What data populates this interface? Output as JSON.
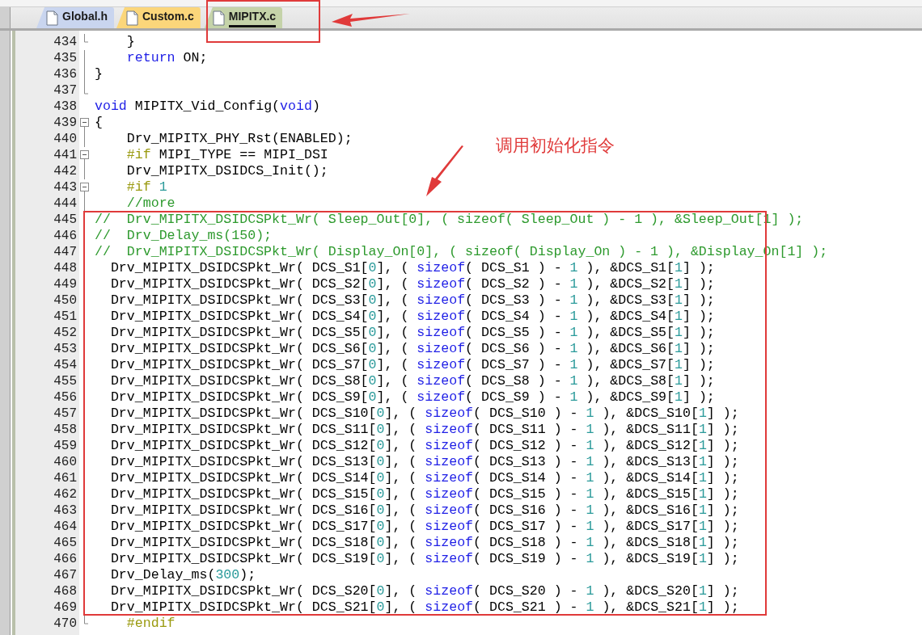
{
  "tabs": [
    {
      "label": "Global.h",
      "color": "#c9d5ef",
      "selected": false
    },
    {
      "label": "Custom.c",
      "color": "#fbd67a",
      "selected": false
    },
    {
      "label": "MIPITX.c",
      "color": "#c5d3a9",
      "selected": true
    }
  ],
  "editor": {
    "lines": [
      {
        "number": "434",
        "kind": "tick",
        "tokens": [
          {
            "kind": "plain",
            "text": "    }"
          }
        ]
      },
      {
        "number": "435",
        "kind": "line",
        "tokens": [
          {
            "kind": "keyword",
            "text": "    return"
          },
          {
            "kind": "plain",
            "text": " ON;"
          }
        ]
      },
      {
        "number": "436",
        "kind": "line",
        "tokens": [
          {
            "kind": "plain",
            "text": "}"
          }
        ]
      },
      {
        "number": "437",
        "kind": "end"
      },
      {
        "number": "438",
        "tokens": [
          {
            "kind": "keyword",
            "text": "void"
          },
          {
            "kind": "plain",
            "text": " MIPITX_Vid_Config("
          },
          {
            "kind": "keyword",
            "text": "void"
          },
          {
            "kind": "plain",
            "text": ")"
          }
        ]
      },
      {
        "number": "439",
        "kind": "box",
        "tokens": [
          {
            "kind": "plain",
            "text": "{"
          }
        ]
      },
      {
        "number": "440",
        "kind": "line",
        "tokens": [
          {
            "kind": "plain",
            "text": "    Drv_MIPITX_PHY_Rst(ENABLED);"
          }
        ]
      },
      {
        "number": "441",
        "kind": "box",
        "tokens": [
          {
            "kind": "preproc",
            "text": "    #if"
          },
          {
            "kind": "plain",
            "text": " MIPI_TYPE == MIPI_DSI"
          }
        ]
      },
      {
        "number": "442",
        "kind": "line",
        "tokens": [
          {
            "kind": "plain",
            "text": "    Drv_MIPITX_DSIDCS_Init();"
          }
        ]
      },
      {
        "number": "443",
        "kind": "box",
        "tokens": [
          {
            "kind": "preproc",
            "text": "    #if"
          },
          {
            "kind": "number",
            "text": " 1"
          }
        ]
      },
      {
        "number": "444",
        "kind": "line",
        "tokens": [
          {
            "kind": "comment",
            "text": "    //more"
          }
        ]
      },
      {
        "number": "445",
        "tokens": [
          {
            "kind": "comment",
            "text": "//  Drv_MIPITX_DSIDCSPkt_Wr( Sleep_Out[0], ( sizeof( Sleep_Out ) - 1 ), &Sleep_Out[1] );"
          }
        ]
      },
      {
        "number": "446",
        "tokens": [
          {
            "kind": "comment",
            "text": "//  Drv_Delay_ms(150);"
          }
        ]
      },
      {
        "number": "447",
        "tokens": [
          {
            "kind": "comment",
            "text": "//  Drv_MIPITX_DSIDCSPkt_Wr( Display_On[0], ( sizeof( Display_On ) - 1 ), &Display_On[1] );"
          }
        ]
      },
      {
        "number": "448",
        "tokens": [
          {
            "kind": "plain",
            "text": "  Drv_MIPITX_DSIDCSPkt_Wr( DCS_S1["
          },
          {
            "kind": "number",
            "text": "0"
          },
          {
            "kind": "plain",
            "text": "], ( "
          },
          {
            "kind": "keyword",
            "text": "sizeof"
          },
          {
            "kind": "plain",
            "text": "( DCS_S1 ) - "
          },
          {
            "kind": "number",
            "text": "1"
          },
          {
            "kind": "plain",
            "text": " ), &DCS_S1["
          },
          {
            "kind": "number",
            "text": "1"
          },
          {
            "kind": "plain",
            "text": "] );"
          }
        ]
      },
      {
        "number": "449",
        "tokens": [
          {
            "kind": "plain",
            "text": "  Drv_MIPITX_DSIDCSPkt_Wr( DCS_S2["
          },
          {
            "kind": "number",
            "text": "0"
          },
          {
            "kind": "plain",
            "text": "], ( "
          },
          {
            "kind": "keyword",
            "text": "sizeof"
          },
          {
            "kind": "plain",
            "text": "( DCS_S2 ) - "
          },
          {
            "kind": "number",
            "text": "1"
          },
          {
            "kind": "plain",
            "text": " ), &DCS_S2["
          },
          {
            "kind": "number",
            "text": "1"
          },
          {
            "kind": "plain",
            "text": "] );"
          }
        ]
      },
      {
        "number": "450",
        "tokens": [
          {
            "kind": "plain",
            "text": "  Drv_MIPITX_DSIDCSPkt_Wr( DCS_S3["
          },
          {
            "kind": "number",
            "text": "0"
          },
          {
            "kind": "plain",
            "text": "], ( "
          },
          {
            "kind": "keyword",
            "text": "sizeof"
          },
          {
            "kind": "plain",
            "text": "( DCS_S3 ) - "
          },
          {
            "kind": "number",
            "text": "1"
          },
          {
            "kind": "plain",
            "text": " ), &DCS_S3["
          },
          {
            "kind": "number",
            "text": "1"
          },
          {
            "kind": "plain",
            "text": "] );"
          }
        ]
      },
      {
        "number": "451",
        "tokens": [
          {
            "kind": "plain",
            "text": "  Drv_MIPITX_DSIDCSPkt_Wr( DCS_S4["
          },
          {
            "kind": "number",
            "text": "0"
          },
          {
            "kind": "plain",
            "text": "], ( "
          },
          {
            "kind": "keyword",
            "text": "sizeof"
          },
          {
            "kind": "plain",
            "text": "( DCS_S4 ) - "
          },
          {
            "kind": "number",
            "text": "1"
          },
          {
            "kind": "plain",
            "text": " ), &DCS_S4["
          },
          {
            "kind": "number",
            "text": "1"
          },
          {
            "kind": "plain",
            "text": "] );"
          }
        ]
      },
      {
        "number": "452",
        "tokens": [
          {
            "kind": "plain",
            "text": "  Drv_MIPITX_DSIDCSPkt_Wr( DCS_S5["
          },
          {
            "kind": "number",
            "text": "0"
          },
          {
            "kind": "plain",
            "text": "], ( "
          },
          {
            "kind": "keyword",
            "text": "sizeof"
          },
          {
            "kind": "plain",
            "text": "( DCS_S5 ) - "
          },
          {
            "kind": "number",
            "text": "1"
          },
          {
            "kind": "plain",
            "text": " ), &DCS_S5["
          },
          {
            "kind": "number",
            "text": "1"
          },
          {
            "kind": "plain",
            "text": "] );"
          }
        ]
      },
      {
        "number": "453",
        "tokens": [
          {
            "kind": "plain",
            "text": "  Drv_MIPITX_DSIDCSPkt_Wr( DCS_S6["
          },
          {
            "kind": "number",
            "text": "0"
          },
          {
            "kind": "plain",
            "text": "], ( "
          },
          {
            "kind": "keyword",
            "text": "sizeof"
          },
          {
            "kind": "plain",
            "text": "( DCS_S6 ) - "
          },
          {
            "kind": "number",
            "text": "1"
          },
          {
            "kind": "plain",
            "text": " ), &DCS_S6["
          },
          {
            "kind": "number",
            "text": "1"
          },
          {
            "kind": "plain",
            "text": "] );"
          }
        ]
      },
      {
        "number": "454",
        "tokens": [
          {
            "kind": "plain",
            "text": "  Drv_MIPITX_DSIDCSPkt_Wr( DCS_S7["
          },
          {
            "kind": "number",
            "text": "0"
          },
          {
            "kind": "plain",
            "text": "], ( "
          },
          {
            "kind": "keyword",
            "text": "sizeof"
          },
          {
            "kind": "plain",
            "text": "( DCS_S7 ) - "
          },
          {
            "kind": "number",
            "text": "1"
          },
          {
            "kind": "plain",
            "text": " ), &DCS_S7["
          },
          {
            "kind": "number",
            "text": "1"
          },
          {
            "kind": "plain",
            "text": "] );"
          }
        ]
      },
      {
        "number": "455",
        "tokens": [
          {
            "kind": "plain",
            "text": "  Drv_MIPITX_DSIDCSPkt_Wr( DCS_S8["
          },
          {
            "kind": "number",
            "text": "0"
          },
          {
            "kind": "plain",
            "text": "], ( "
          },
          {
            "kind": "keyword",
            "text": "sizeof"
          },
          {
            "kind": "plain",
            "text": "( DCS_S8 ) - "
          },
          {
            "kind": "number",
            "text": "1"
          },
          {
            "kind": "plain",
            "text": " ), &DCS_S8["
          },
          {
            "kind": "number",
            "text": "1"
          },
          {
            "kind": "plain",
            "text": "] );"
          }
        ]
      },
      {
        "number": "456",
        "tokens": [
          {
            "kind": "plain",
            "text": "  Drv_MIPITX_DSIDCSPkt_Wr( DCS_S9["
          },
          {
            "kind": "number",
            "text": "0"
          },
          {
            "kind": "plain",
            "text": "], ( "
          },
          {
            "kind": "keyword",
            "text": "sizeof"
          },
          {
            "kind": "plain",
            "text": "( DCS_S9 ) - "
          },
          {
            "kind": "number",
            "text": "1"
          },
          {
            "kind": "plain",
            "text": " ), &DCS_S9["
          },
          {
            "kind": "number",
            "text": "1"
          },
          {
            "kind": "plain",
            "text": "] );"
          }
        ]
      },
      {
        "number": "457",
        "tokens": [
          {
            "kind": "plain",
            "text": "  Drv_MIPITX_DSIDCSPkt_Wr( DCS_S10["
          },
          {
            "kind": "number",
            "text": "0"
          },
          {
            "kind": "plain",
            "text": "], ( "
          },
          {
            "kind": "keyword",
            "text": "sizeof"
          },
          {
            "kind": "plain",
            "text": "( DCS_S10 ) - "
          },
          {
            "kind": "number",
            "text": "1"
          },
          {
            "kind": "plain",
            "text": " ), &DCS_S10["
          },
          {
            "kind": "number",
            "text": "1"
          },
          {
            "kind": "plain",
            "text": "] );"
          }
        ]
      },
      {
        "number": "458",
        "tokens": [
          {
            "kind": "plain",
            "text": "  Drv_MIPITX_DSIDCSPkt_Wr( DCS_S11["
          },
          {
            "kind": "number",
            "text": "0"
          },
          {
            "kind": "plain",
            "text": "], ( "
          },
          {
            "kind": "keyword",
            "text": "sizeof"
          },
          {
            "kind": "plain",
            "text": "( DCS_S11 ) - "
          },
          {
            "kind": "number",
            "text": "1"
          },
          {
            "kind": "plain",
            "text": " ), &DCS_S11["
          },
          {
            "kind": "number",
            "text": "1"
          },
          {
            "kind": "plain",
            "text": "] );"
          }
        ]
      },
      {
        "number": "459",
        "tokens": [
          {
            "kind": "plain",
            "text": "  Drv_MIPITX_DSIDCSPkt_Wr( DCS_S12["
          },
          {
            "kind": "number",
            "text": "0"
          },
          {
            "kind": "plain",
            "text": "], ( "
          },
          {
            "kind": "keyword",
            "text": "sizeof"
          },
          {
            "kind": "plain",
            "text": "( DCS_S12 ) - "
          },
          {
            "kind": "number",
            "text": "1"
          },
          {
            "kind": "plain",
            "text": " ), &DCS_S12["
          },
          {
            "kind": "number",
            "text": "1"
          },
          {
            "kind": "plain",
            "text": "] );"
          }
        ]
      },
      {
        "number": "460",
        "tokens": [
          {
            "kind": "plain",
            "text": "  Drv_MIPITX_DSIDCSPkt_Wr( DCS_S13["
          },
          {
            "kind": "number",
            "text": "0"
          },
          {
            "kind": "plain",
            "text": "], ( "
          },
          {
            "kind": "keyword",
            "text": "sizeof"
          },
          {
            "kind": "plain",
            "text": "( DCS_S13 ) - "
          },
          {
            "kind": "number",
            "text": "1"
          },
          {
            "kind": "plain",
            "text": " ), &DCS_S13["
          },
          {
            "kind": "number",
            "text": "1"
          },
          {
            "kind": "plain",
            "text": "] );"
          }
        ]
      },
      {
        "number": "461",
        "tokens": [
          {
            "kind": "plain",
            "text": "  Drv_MIPITX_DSIDCSPkt_Wr( DCS_S14["
          },
          {
            "kind": "number",
            "text": "0"
          },
          {
            "kind": "plain",
            "text": "], ( "
          },
          {
            "kind": "keyword",
            "text": "sizeof"
          },
          {
            "kind": "plain",
            "text": "( DCS_S14 ) - "
          },
          {
            "kind": "number",
            "text": "1"
          },
          {
            "kind": "plain",
            "text": " ), &DCS_S14["
          },
          {
            "kind": "number",
            "text": "1"
          },
          {
            "kind": "plain",
            "text": "] );"
          }
        ]
      },
      {
        "number": "462",
        "tokens": [
          {
            "kind": "plain",
            "text": "  Drv_MIPITX_DSIDCSPkt_Wr( DCS_S15["
          },
          {
            "kind": "number",
            "text": "0"
          },
          {
            "kind": "plain",
            "text": "], ( "
          },
          {
            "kind": "keyword",
            "text": "sizeof"
          },
          {
            "kind": "plain",
            "text": "( DCS_S15 ) - "
          },
          {
            "kind": "number",
            "text": "1"
          },
          {
            "kind": "plain",
            "text": " ), &DCS_S15["
          },
          {
            "kind": "number",
            "text": "1"
          },
          {
            "kind": "plain",
            "text": "] );"
          }
        ]
      },
      {
        "number": "463",
        "tokens": [
          {
            "kind": "plain",
            "text": "  Drv_MIPITX_DSIDCSPkt_Wr( DCS_S16["
          },
          {
            "kind": "number",
            "text": "0"
          },
          {
            "kind": "plain",
            "text": "], ( "
          },
          {
            "kind": "keyword",
            "text": "sizeof"
          },
          {
            "kind": "plain",
            "text": "( DCS_S16 ) - "
          },
          {
            "kind": "number",
            "text": "1"
          },
          {
            "kind": "plain",
            "text": " ), &DCS_S16["
          },
          {
            "kind": "number",
            "text": "1"
          },
          {
            "kind": "plain",
            "text": "] );"
          }
        ]
      },
      {
        "number": "464",
        "tokens": [
          {
            "kind": "plain",
            "text": "  Drv_MIPITX_DSIDCSPkt_Wr( DCS_S17["
          },
          {
            "kind": "number",
            "text": "0"
          },
          {
            "kind": "plain",
            "text": "], ( "
          },
          {
            "kind": "keyword",
            "text": "sizeof"
          },
          {
            "kind": "plain",
            "text": "( DCS_S17 ) - "
          },
          {
            "kind": "number",
            "text": "1"
          },
          {
            "kind": "plain",
            "text": " ), &DCS_S17["
          },
          {
            "kind": "number",
            "text": "1"
          },
          {
            "kind": "plain",
            "text": "] );"
          }
        ]
      },
      {
        "number": "465",
        "tokens": [
          {
            "kind": "plain",
            "text": "  Drv_MIPITX_DSIDCSPkt_Wr( DCS_S18["
          },
          {
            "kind": "number",
            "text": "0"
          },
          {
            "kind": "plain",
            "text": "], ( "
          },
          {
            "kind": "keyword",
            "text": "sizeof"
          },
          {
            "kind": "plain",
            "text": "( DCS_S18 ) - "
          },
          {
            "kind": "number",
            "text": "1"
          },
          {
            "kind": "plain",
            "text": " ), &DCS_S18["
          },
          {
            "kind": "number",
            "text": "1"
          },
          {
            "kind": "plain",
            "text": "] );"
          }
        ]
      },
      {
        "number": "466",
        "tokens": [
          {
            "kind": "plain",
            "text": "  Drv_MIPITX_DSIDCSPkt_Wr( DCS_S19["
          },
          {
            "kind": "number",
            "text": "0"
          },
          {
            "kind": "plain",
            "text": "], ( "
          },
          {
            "kind": "keyword",
            "text": "sizeof"
          },
          {
            "kind": "plain",
            "text": "( DCS_S19 ) - "
          },
          {
            "kind": "number",
            "text": "1"
          },
          {
            "kind": "plain",
            "text": " ), &DCS_S19["
          },
          {
            "kind": "number",
            "text": "1"
          },
          {
            "kind": "plain",
            "text": "] );"
          }
        ]
      },
      {
        "number": "467",
        "tokens": [
          {
            "kind": "plain",
            "text": "  Drv_Delay_ms("
          },
          {
            "kind": "number",
            "text": "300"
          },
          {
            "kind": "plain",
            "text": ");"
          }
        ]
      },
      {
        "number": "468",
        "tokens": [
          {
            "kind": "plain",
            "text": "  Drv_MIPITX_DSIDCSPkt_Wr( DCS_S20["
          },
          {
            "kind": "number",
            "text": "0"
          },
          {
            "kind": "plain",
            "text": "], ( "
          },
          {
            "kind": "keyword",
            "text": "sizeof"
          },
          {
            "kind": "plain",
            "text": "( DCS_S20 ) - "
          },
          {
            "kind": "number",
            "text": "1"
          },
          {
            "kind": "plain",
            "text": " ), &DCS_S20["
          },
          {
            "kind": "number",
            "text": "1"
          },
          {
            "kind": "plain",
            "text": "] );"
          }
        ]
      },
      {
        "number": "469",
        "tokens": [
          {
            "kind": "plain",
            "text": "  Drv_MIPITX_DSIDCSPkt_Wr( DCS_S21["
          },
          {
            "kind": "number",
            "text": "0"
          },
          {
            "kind": "plain",
            "text": "], ( "
          },
          {
            "kind": "keyword",
            "text": "sizeof"
          },
          {
            "kind": "plain",
            "text": "( DCS_S21 ) - "
          },
          {
            "kind": "number",
            "text": "1"
          },
          {
            "kind": "plain",
            "text": " ), &DCS_S21["
          },
          {
            "kind": "number",
            "text": "1"
          },
          {
            "kind": "plain",
            "text": "] );"
          }
        ]
      },
      {
        "number": "470",
        "kind": "tick",
        "tokens": [
          {
            "kind": "preproc",
            "text": "    #endif"
          }
        ]
      }
    ]
  },
  "annotation": {
    "text": "调用初始化指令"
  }
}
